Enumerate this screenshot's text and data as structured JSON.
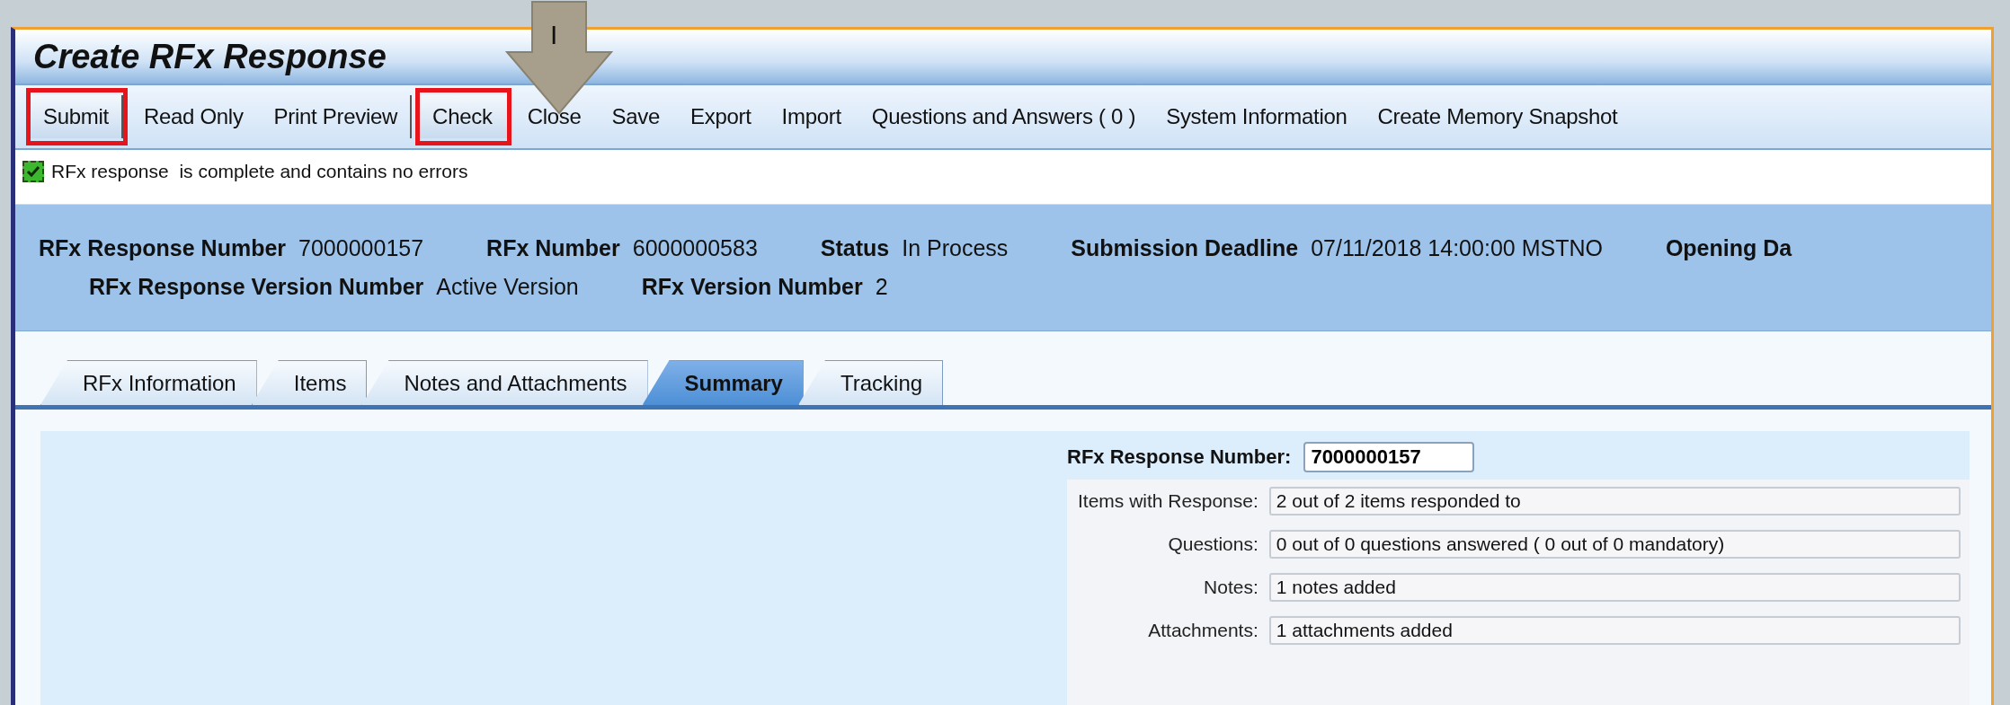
{
  "window": {
    "title": "Create RFx Response"
  },
  "callout_arrow": {
    "label": "I"
  },
  "toolbar": [
    {
      "label": "Submit",
      "highlighted": true,
      "separator_after": true
    },
    {
      "label": "Read Only",
      "highlighted": false,
      "separator_after": false
    },
    {
      "label": "Print Preview",
      "highlighted": false,
      "separator_after": true
    },
    {
      "label": "Check",
      "highlighted": true,
      "separator_after": false
    },
    {
      "label": "Close",
      "highlighted": false,
      "separator_after": false
    },
    {
      "label": "Save",
      "highlighted": false,
      "separator_after": false
    },
    {
      "label": "Export",
      "highlighted": false,
      "separator_after": false
    },
    {
      "label": "Import",
      "highlighted": false,
      "separator_after": false
    },
    {
      "label": "Questions and Answers ( 0 )",
      "highlighted": false,
      "separator_after": false
    },
    {
      "label": "System Information",
      "highlighted": false,
      "separator_after": false
    },
    {
      "label": "Create Memory Snapshot",
      "highlighted": false,
      "separator_after": false
    }
  ],
  "status_message": {
    "checked": true,
    "text": "RFx response  is complete and contains no errors"
  },
  "header": {
    "rows": [
      [
        {
          "label": "RFx Response Number",
          "value": "7000000157"
        },
        {
          "label": "RFx Number",
          "value": "6000000583"
        },
        {
          "label": "Status",
          "value": "In Process"
        },
        {
          "label": "Submission Deadline",
          "value": "07/11/2018 14:00:00 MSTNO"
        },
        {
          "label": "Opening Da"
        }
      ],
      [
        {
          "label": "RFx Response Version Number",
          "value": "Active Version"
        },
        {
          "label": "RFx Version Number",
          "value": "2"
        }
      ]
    ]
  },
  "tabs": [
    {
      "label": "RFx Information",
      "selected": false
    },
    {
      "label": "Items",
      "selected": false
    },
    {
      "label": "Notes and Attachments",
      "selected": false
    },
    {
      "label": "Summary",
      "selected": true
    },
    {
      "label": "Tracking",
      "selected": false
    }
  ],
  "summary": {
    "response_number": {
      "label": "RFx Response Number:",
      "value": "7000000157"
    },
    "rows": [
      {
        "label": "Items with Response:",
        "value": "2 out of 2 items responded to"
      },
      {
        "label": "Questions:",
        "value": "0 out of 0 questions answered ( 0 out of 0 mandatory)"
      },
      {
        "label": "Notes:",
        "value": "1 notes added"
      },
      {
        "label": "Attachments:",
        "value": "1 attachments added"
      }
    ]
  }
}
